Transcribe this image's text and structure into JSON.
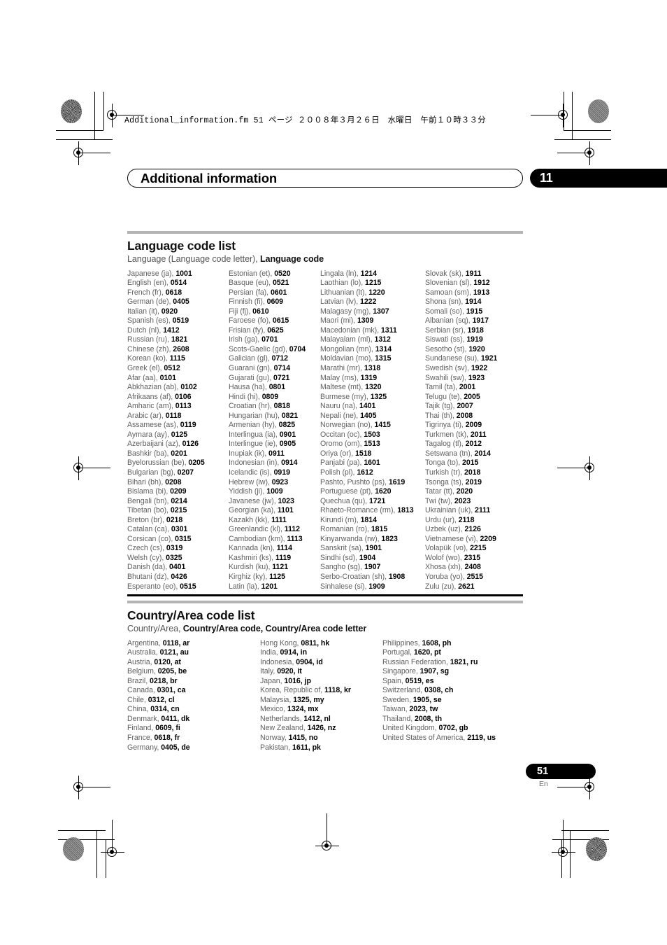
{
  "print_marks": {
    "file_header": "Additional_information.fm  51 ページ  ２００８年３月２６日　水曜日　午前１０時３３分"
  },
  "chapter": {
    "title": "Additional information",
    "number": "11"
  },
  "footer": {
    "page_number": "51",
    "language_mark": "En"
  },
  "language_section": {
    "title": "Language code list",
    "subtitle_plain": "Language (Language code letter), ",
    "subtitle_bold": "Language code",
    "columns": [
      [
        {
          "name": "Japanese (ja), ",
          "code": "1001"
        },
        {
          "name": "English (en), ",
          "code": "0514"
        },
        {
          "name": "French (fr), ",
          "code": "0618"
        },
        {
          "name": "German (de), ",
          "code": "0405"
        },
        {
          "name": "Italian (it), ",
          "code": "0920"
        },
        {
          "name": "Spanish (es), ",
          "code": "0519"
        },
        {
          "name": "Dutch (nl), ",
          "code": "1412"
        },
        {
          "name": "Russian (ru), ",
          "code": "1821"
        },
        {
          "name": "Chinese (zh), ",
          "code": "2608"
        },
        {
          "name": "Korean (ko), ",
          "code": "1115"
        },
        {
          "name": "Greek (el), ",
          "code": "0512"
        },
        {
          "name": "Afar (aa), ",
          "code": "0101"
        },
        {
          "name": "Abkhazian (ab), ",
          "code": "0102"
        },
        {
          "name": "Afrikaans (af), ",
          "code": "0106"
        },
        {
          "name": "Amharic (am), ",
          "code": "0113"
        },
        {
          "name": "Arabic (ar), ",
          "code": "0118"
        },
        {
          "name": "Assamese (as), ",
          "code": "0119"
        },
        {
          "name": "Aymara (ay), ",
          "code": "0125"
        },
        {
          "name": "Azerbaijani (az), ",
          "code": "0126"
        },
        {
          "name": "Bashkir (ba), ",
          "code": "0201"
        },
        {
          "name": "Byelorussian (be), ",
          "code": "0205"
        },
        {
          "name": "Bulgarian (bg), ",
          "code": "0207"
        },
        {
          "name": "Bihari (bh), ",
          "code": "0208"
        },
        {
          "name": "Bislama (bi), ",
          "code": "0209"
        },
        {
          "name": "Bengali (bn), ",
          "code": "0214"
        },
        {
          "name": "Tibetan (bo), ",
          "code": "0215"
        },
        {
          "name": "Breton (br), ",
          "code": "0218"
        },
        {
          "name": "Catalan (ca), ",
          "code": "0301"
        },
        {
          "name": "Corsican (co), ",
          "code": "0315"
        },
        {
          "name": "Czech (cs), ",
          "code": "0319"
        },
        {
          "name": "Welsh (cy), ",
          "code": "0325"
        },
        {
          "name": "Danish (da), ",
          "code": "0401"
        },
        {
          "name": "Bhutani (dz), ",
          "code": "0426"
        },
        {
          "name": "Esperanto (eo), ",
          "code": "0515"
        }
      ],
      [
        {
          "name": "Estonian (et), ",
          "code": "0520"
        },
        {
          "name": "Basque (eu), ",
          "code": "0521"
        },
        {
          "name": "Persian (fa), ",
          "code": "0601"
        },
        {
          "name": "Finnish (fi), ",
          "code": "0609"
        },
        {
          "name": "Fiji (fj), ",
          "code": "0610"
        },
        {
          "name": "Faroese (fo), ",
          "code": "0615"
        },
        {
          "name": "Frisian (fy), ",
          "code": "0625"
        },
        {
          "name": "Irish (ga), ",
          "code": "0701"
        },
        {
          "name": "Scots-Gaelic (gd), ",
          "code": "0704"
        },
        {
          "name": "Galician (gl), ",
          "code": "0712"
        },
        {
          "name": "Guarani (gn), ",
          "code": "0714"
        },
        {
          "name": "Gujarati (gu), ",
          "code": "0721"
        },
        {
          "name": "Hausa (ha), ",
          "code": "0801"
        },
        {
          "name": "Hindi (hi), ",
          "code": "0809"
        },
        {
          "name": "Croatian (hr), ",
          "code": "0818"
        },
        {
          "name": "Hungarian (hu), ",
          "code": "0821"
        },
        {
          "name": "Armenian (hy), ",
          "code": "0825"
        },
        {
          "name": "Interlingua (ia), ",
          "code": "0901"
        },
        {
          "name": "Interlingue (ie), ",
          "code": "0905"
        },
        {
          "name": "Inupiak (ik), ",
          "code": "0911"
        },
        {
          "name": "Indonesian (in), ",
          "code": "0914"
        },
        {
          "name": "Icelandic (is), ",
          "code": "0919"
        },
        {
          "name": "Hebrew (iw), ",
          "code": "0923"
        },
        {
          "name": "Yiddish (ji), ",
          "code": "1009"
        },
        {
          "name": "Javanese (jw), ",
          "code": "1023"
        },
        {
          "name": "Georgian (ka), ",
          "code": "1101"
        },
        {
          "name": "Kazakh (kk), ",
          "code": "1111"
        },
        {
          "name": "Greenlandic  (kl), ",
          "code": "1112"
        },
        {
          "name": "Cambodian (km), ",
          "code": "1113"
        },
        {
          "name": "Kannada (kn), ",
          "code": "1114"
        },
        {
          "name": "Kashmiri (ks), ",
          "code": "1119"
        },
        {
          "name": "Kurdish (ku), ",
          "code": "1121"
        },
        {
          "name": "Kirghiz (ky), ",
          "code": "1125"
        },
        {
          "name": "Latin (la), ",
          "code": "1201"
        }
      ],
      [
        {
          "name": "Lingala (ln), ",
          "code": "1214"
        },
        {
          "name": "Laothian (lo), ",
          "code": "1215"
        },
        {
          "name": "Lithuanian (lt), ",
          "code": "1220"
        },
        {
          "name": "Latvian (lv), ",
          "code": "1222"
        },
        {
          "name": "Malagasy (mg), ",
          "code": "1307"
        },
        {
          "name": "Maori (mi), ",
          "code": "1309"
        },
        {
          "name": "Macedonian (mk), ",
          "code": "1311"
        },
        {
          "name": "Malayalam  (ml), ",
          "code": "1312"
        },
        {
          "name": "Mongolian (mn), ",
          "code": "1314"
        },
        {
          "name": "Moldavian (mo), ",
          "code": "1315"
        },
        {
          "name": "Marathi (mr), ",
          "code": "1318"
        },
        {
          "name": "Malay  (ms), ",
          "code": "1319"
        },
        {
          "name": "Maltese (mt), ",
          "code": "1320"
        },
        {
          "name": "Burmese (my), ",
          "code": "1325"
        },
        {
          "name": "Nauru (na), ",
          "code": "1401"
        },
        {
          "name": "Nepali (ne), ",
          "code": "1405"
        },
        {
          "name": "Norwegian (no), ",
          "code": "1415"
        },
        {
          "name": "Occitan (oc), ",
          "code": "1503"
        },
        {
          "name": "Oromo (om), ",
          "code": "1513"
        },
        {
          "name": "Oriya (or), ",
          "code": "1518"
        },
        {
          "name": "Panjabi (pa), ",
          "code": "1601"
        },
        {
          "name": "Polish (pl), ",
          "code": "1612"
        },
        {
          "name": "Pashto, Pushto (ps), ",
          "code": "1619"
        },
        {
          "name": "Portuguese (pt), ",
          "code": "1620"
        },
        {
          "name": "Quechua (qu), ",
          "code": "1721"
        },
        {
          "name": "Rhaeto-Romance (rm), ",
          "code": "1813"
        },
        {
          "name": "Kirundi (rn), ",
          "code": "1814"
        },
        {
          "name": "Romanian (ro), ",
          "code": "1815"
        },
        {
          "name": "Kinyarwanda (rw), ",
          "code": "1823"
        },
        {
          "name": "Sanskrit (sa), ",
          "code": "1901"
        },
        {
          "name": "Sindhi (sd), ",
          "code": "1904"
        },
        {
          "name": "Sangho (sg), ",
          "code": "1907"
        },
        {
          "name": "Serbo-Croatian (sh), ",
          "code": "1908"
        },
        {
          "name": "Sinhalese (si), ",
          "code": "1909"
        }
      ],
      [
        {
          "name": "Slovak (sk), ",
          "code": "1911"
        },
        {
          "name": "Slovenian (sl), ",
          "code": "1912"
        },
        {
          "name": "Samoan (sm), ",
          "code": "1913"
        },
        {
          "name": "Shona (sn), ",
          "code": "1914"
        },
        {
          "name": "Somali (so), ",
          "code": "1915"
        },
        {
          "name": "Albanian (sq), ",
          "code": "1917"
        },
        {
          "name": "Serbian (sr), ",
          "code": "1918"
        },
        {
          "name": "Siswati (ss), ",
          "code": "1919"
        },
        {
          "name": "Sesotho (st), ",
          "code": "1920"
        },
        {
          "name": "Sundanese (su), ",
          "code": "1921"
        },
        {
          "name": "Swedish (sv), ",
          "code": "1922"
        },
        {
          "name": "Swahili (sw), ",
          "code": "1923"
        },
        {
          "name": "Tamil (ta), ",
          "code": "2001"
        },
        {
          "name": "Telugu (te), ",
          "code": "2005"
        },
        {
          "name": "Tajik (tg), ",
          "code": "2007"
        },
        {
          "name": "Thai (th), ",
          "code": "2008"
        },
        {
          "name": "Tigrinya (ti), ",
          "code": "2009"
        },
        {
          "name": "Turkmen (tk), ",
          "code": "2011"
        },
        {
          "name": "Tagalog (tl), ",
          "code": "2012"
        },
        {
          "name": "Setswana (tn), ",
          "code": "2014"
        },
        {
          "name": "Tonga (to), ",
          "code": "2015"
        },
        {
          "name": "Turkish (tr), ",
          "code": "2018"
        },
        {
          "name": "Tsonga (ts), ",
          "code": "2019"
        },
        {
          "name": "Tatar (tt), ",
          "code": "2020"
        },
        {
          "name": "Twi (tw), ",
          "code": "2023"
        },
        {
          "name": "Ukrainian (uk), ",
          "code": "2111"
        },
        {
          "name": "Urdu (ur), ",
          "code": "2118"
        },
        {
          "name": "Uzbek (uz), ",
          "code": "2126"
        },
        {
          "name": "Vietnamese (vi), ",
          "code": "2209"
        },
        {
          "name": "Volapük (vo), ",
          "code": "2215"
        },
        {
          "name": "Wolof (wo), ",
          "code": "2315"
        },
        {
          "name": "Xhosa (xh), ",
          "code": "2408"
        },
        {
          "name": "Yoruba (yo), ",
          "code": "2515"
        },
        {
          "name": "Zulu (zu), ",
          "code": "2621"
        }
      ]
    ]
  },
  "country_section": {
    "title": "Country/Area code list",
    "subtitle_plain": "Country/Area, ",
    "subtitle_bold": "Country/Area code, Country/Area code letter",
    "columns": [
      [
        {
          "name": "Argentina, ",
          "code": "0118, ar"
        },
        {
          "name": "Australia, ",
          "code": "0121, au"
        },
        {
          "name": "Austria, ",
          "code": "0120, at"
        },
        {
          "name": "Belgium, ",
          "code": "0205, be"
        },
        {
          "name": "Brazil, ",
          "code": "0218, br"
        },
        {
          "name": "Canada, ",
          "code": "0301, ca"
        },
        {
          "name": "Chile, ",
          "code": "0312, cl"
        },
        {
          "name": "China, ",
          "code": "0314, cn"
        },
        {
          "name": "Denmark, ",
          "code": "0411, dk"
        },
        {
          "name": "Finland, ",
          "code": "0609, fi"
        },
        {
          "name": "France, ",
          "code": "0618, fr"
        },
        {
          "name": "Germany, ",
          "code": "0405, de"
        }
      ],
      [
        {
          "name": "Hong Kong, ",
          "code": "0811, hk"
        },
        {
          "name": "India, ",
          "code": "0914, in"
        },
        {
          "name": "Indonesia, ",
          "code": "0904, id"
        },
        {
          "name": "Italy, ",
          "code": "0920, it"
        },
        {
          "name": "Japan, ",
          "code": "1016, jp"
        },
        {
          "name": "Korea, Republic of, ",
          "code": "1118, kr"
        },
        {
          "name": "Malaysia, ",
          "code": "1325, my"
        },
        {
          "name": "Mexico, ",
          "code": "1324, mx"
        },
        {
          "name": "Netherlands, ",
          "code": "1412, nl"
        },
        {
          "name": "New Zealand, ",
          "code": "1426, nz"
        },
        {
          "name": "Norway, ",
          "code": "1415, no"
        },
        {
          "name": "Pakistan, ",
          "code": "1611, pk"
        }
      ],
      [
        {
          "name": "Philippines, ",
          "code": "1608, ph"
        },
        {
          "name": "Portugal, ",
          "code": "1620, pt"
        },
        {
          "name": "Russian Federation, ",
          "code": "1821, ru"
        },
        {
          "name": "Singapore, ",
          "code": "1907, sg"
        },
        {
          "name": "Spain, ",
          "code": "0519, es"
        },
        {
          "name": "Switzerland, ",
          "code": "0308, ch"
        },
        {
          "name": "Sweden, ",
          "code": "1905, se"
        },
        {
          "name": "Taiwan, ",
          "code": "2023, tw"
        },
        {
          "name": "Thailand, ",
          "code": "2008, th"
        },
        {
          "name": "United Kingdom, ",
          "code": "0702, gb"
        },
        {
          "name": "United States of America, ",
          "code": "2119, us"
        }
      ]
    ]
  }
}
